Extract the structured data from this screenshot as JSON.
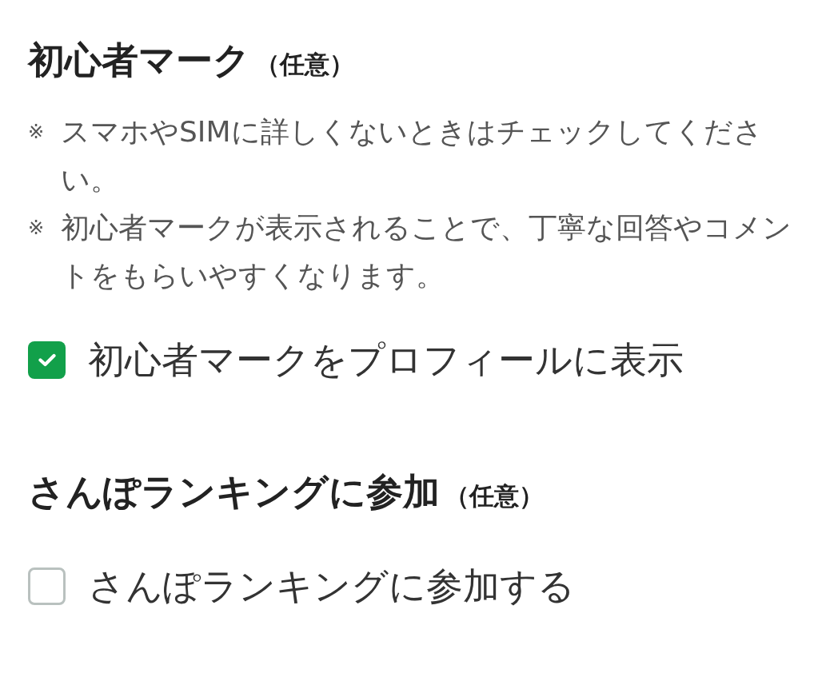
{
  "sections": [
    {
      "title": "初心者マーク",
      "suffix": "（任意）",
      "notes": [
        {
          "mark": "※",
          "text": "スマホやSIMに詳しくないときはチェックしてください。"
        },
        {
          "mark": "※",
          "text": "初心者マークが表示されることで、丁寧な回答やコメントをもらいやすくなります。"
        }
      ],
      "checkbox": {
        "label": "初心者マークをプロフィールに表示",
        "checked": true
      }
    },
    {
      "title": "さんぽランキングに参加",
      "suffix": "（任意）",
      "checkbox": {
        "label": "さんぽランキングに参加する",
        "checked": false
      }
    }
  ]
}
